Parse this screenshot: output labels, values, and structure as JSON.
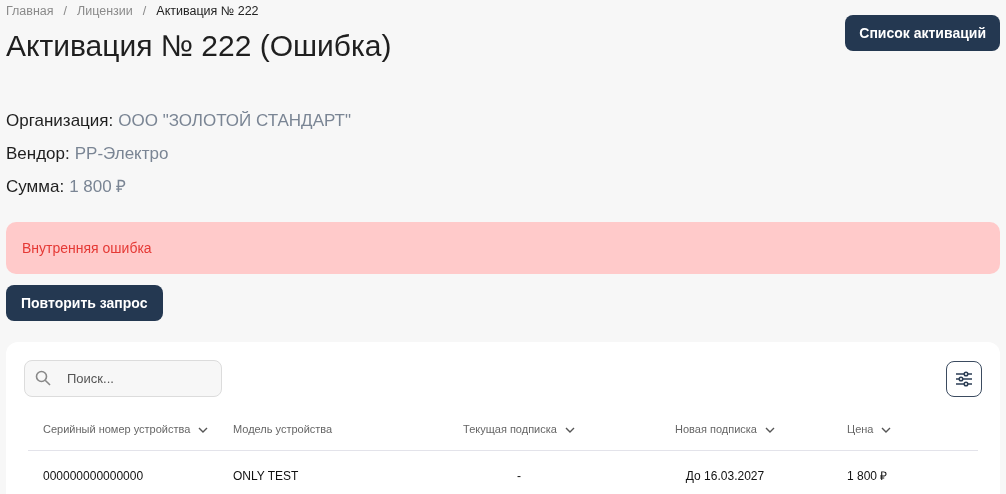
{
  "breadcrumbs": [
    {
      "label": "Главная",
      "current": false
    },
    {
      "label": "Лицензии",
      "current": false,
      "separator": "/"
    },
    {
      "label": "Активация № 222",
      "current": true,
      "separator": "/"
    }
  ],
  "title": "Активация № 222 (Ошибка)",
  "header_button": "Список активаций",
  "details": [
    {
      "label": "Организация:",
      "value": "ООО \"ЗОЛОТОЙ СТАНДАРТ\""
    },
    {
      "label": "Вендор:",
      "value": "РР-Электро"
    },
    {
      "label": "Сумма:",
      "value": "1 800 ₽"
    }
  ],
  "alert": {
    "kind": "error",
    "message": "Внутренняя ошибка"
  },
  "retry_button": "Повторить запрос",
  "search": {
    "placeholder": "Поиск..."
  },
  "table": {
    "columns": [
      {
        "label": "Серийный номер устройства",
        "sortable": true
      },
      {
        "label": "Модель устройства",
        "sortable": false
      },
      {
        "label": "Текущая подписка",
        "sortable": true
      },
      {
        "label": "Новая подписка",
        "sortable": true
      },
      {
        "label": "Цена",
        "sortable": true
      }
    ],
    "rows": [
      [
        "000000000000000",
        "ONLY TEST",
        "-",
        "До 16.03.2027",
        "1 800 ₽"
      ]
    ]
  }
}
